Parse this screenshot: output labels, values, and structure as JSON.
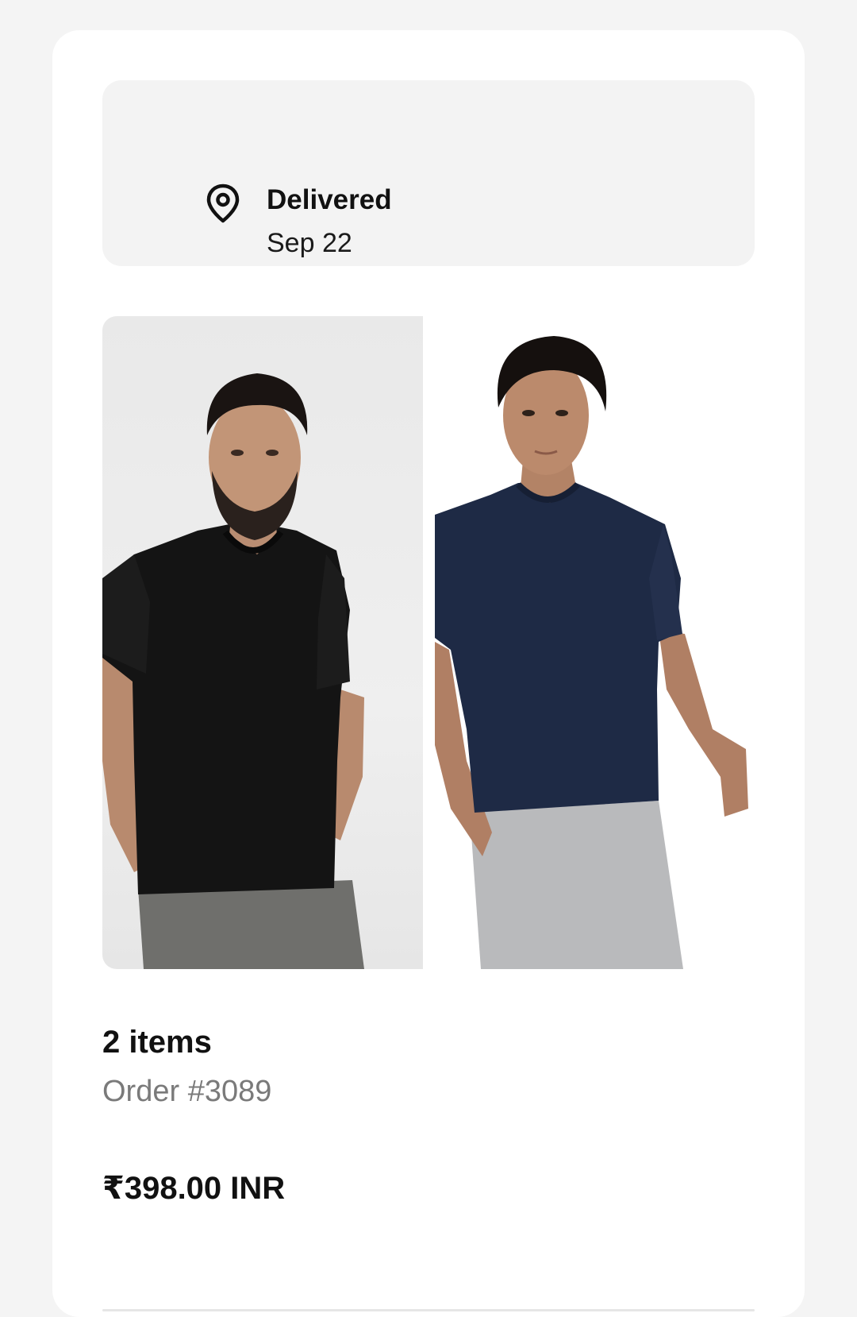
{
  "status": {
    "icon": "location-pin-icon",
    "title": "Delivered",
    "date": "Sep 22"
  },
  "products": [
    {
      "image_description_icon": "product-image",
      "shirt_color": "#141414"
    },
    {
      "image_description_icon": "product-image",
      "shirt_color": "#1e2a45"
    }
  ],
  "order": {
    "items_count": "2 items",
    "order_number": "Order #3089",
    "price": "₹398.00 INR"
  }
}
